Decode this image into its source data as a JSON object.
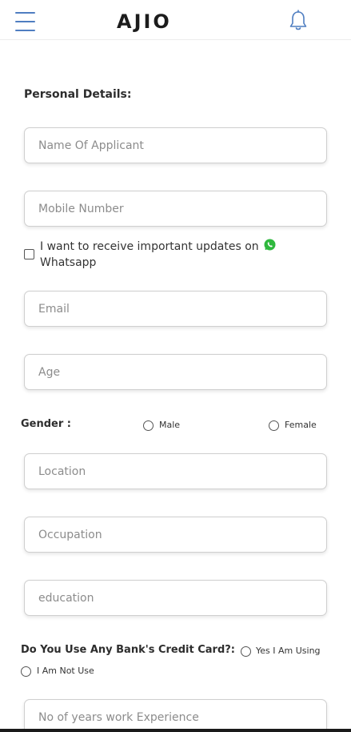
{
  "header": {
    "logo": "AJIO",
    "menu_icon": "hamburger-menu-icon",
    "notification_icon": "bell-icon",
    "accent_color": "#4f7ec1"
  },
  "form": {
    "section_title": "Personal Details:",
    "name_placeholder": "Name Of Applicant",
    "mobile_placeholder": "Mobile Number",
    "whatsapp_label": "I want to receive important updates on Whatsapp",
    "whatsapp_icon": "whatsapp-icon",
    "email_placeholder": "Email",
    "age_placeholder": "Age",
    "gender_label": "Gender :",
    "gender_options": [
      "Male",
      "Female"
    ],
    "location_placeholder": "Location",
    "occupation_placeholder": "Occupation",
    "education_placeholder": "education",
    "credit_card_question": "Do You Use Any Bank's Credit Card?:",
    "credit_card_options": [
      "Yes I Am Using",
      "I Am Not Use"
    ],
    "experience_placeholder": "No of years work Experience"
  }
}
